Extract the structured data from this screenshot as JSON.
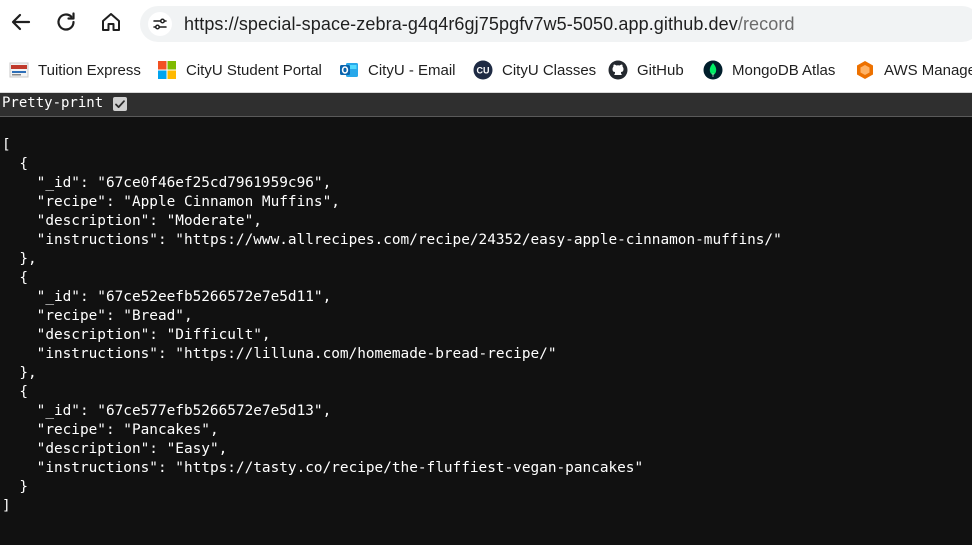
{
  "browser": {
    "url_host": "https://special-space-zebra-g4q4r6gj75pgfv7w5-5050.app.github.dev",
    "url_path": "/record",
    "nav": {
      "back_icon": "back-arrow-icon",
      "reload_icon": "reload-icon",
      "home_icon": "home-icon",
      "site_info_icon": "tune-icon"
    }
  },
  "bookmarks": [
    {
      "label": "Tuition Express",
      "icon": "tuition-express-icon"
    },
    {
      "label": "CityU Student Portal",
      "icon": "microsoft-icon"
    },
    {
      "label": "CityU - Email",
      "icon": "outlook-icon"
    },
    {
      "label": "CityU Classes",
      "icon": "cityu-icon"
    },
    {
      "label": "GitHub",
      "icon": "github-icon"
    },
    {
      "label": "MongoDB Atlas",
      "icon": "mongodb-leaf-icon"
    },
    {
      "label": "AWS Manage",
      "icon": "aws-icon"
    }
  ],
  "pretty_print": {
    "label": "Pretty-print",
    "checked": true
  },
  "records": [
    {
      "_id": "67ce0f46ef25cd7961959c96",
      "recipe": "Apple Cinnamon Muffins",
      "description": "Moderate",
      "instructions": "https://www.allrecipes.com/recipe/24352/easy-apple-cinnamon-muffins/"
    },
    {
      "_id": "67ce52eefb5266572e7e5d11",
      "recipe": "Bread",
      "description": "Difficult",
      "instructions": "https://lilluna.com/homemade-bread-recipe/"
    },
    {
      "_id": "67ce577efb5266572e7e5d13",
      "recipe": "Pancakes",
      "description": "Easy",
      "instructions": "https://tasty.co/recipe/the-fluffiest-vegan-pancakes"
    }
  ],
  "colors": {
    "page_bg": "#111111",
    "pp_bar_bg": "#2f2f2f",
    "text": "#ffffff"
  }
}
